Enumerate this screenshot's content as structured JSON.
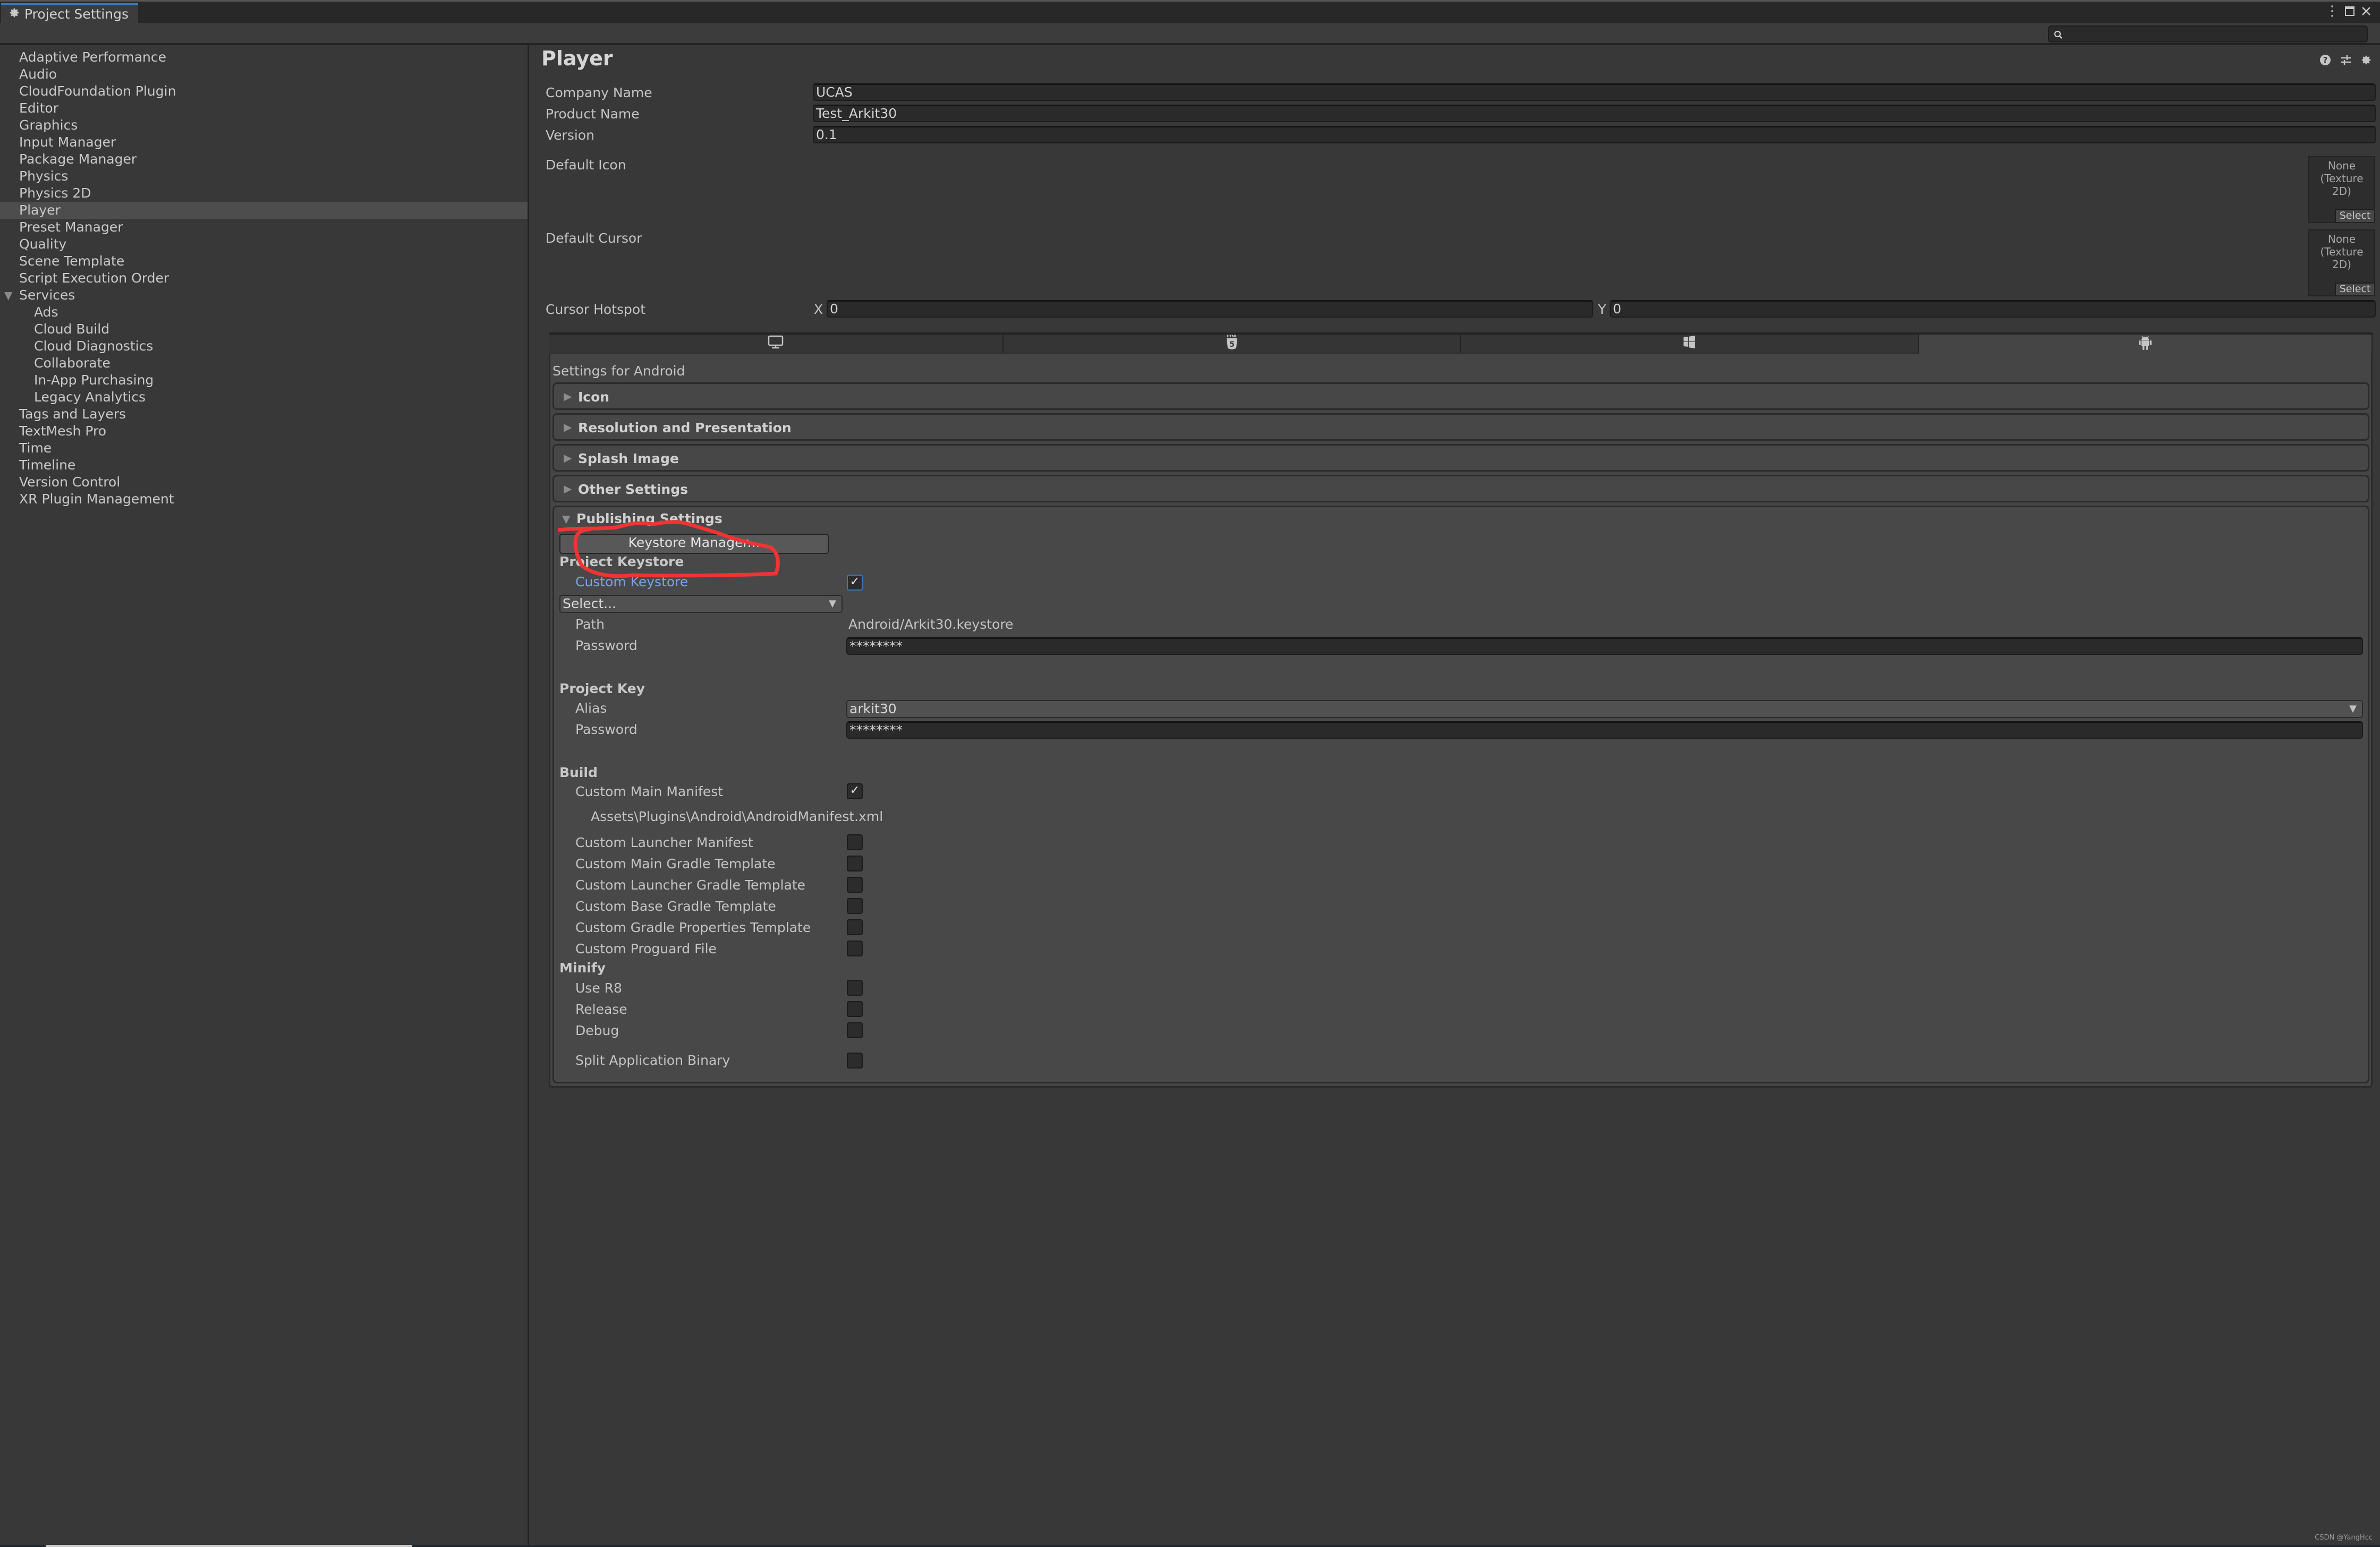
{
  "window": {
    "tab_title": "Project Settings",
    "tab_icon": "gear-icon",
    "controls": [
      "more-options-icon",
      "maximize-icon",
      "close-icon"
    ]
  },
  "search": {
    "placeholder": "",
    "value": ""
  },
  "sidebar": {
    "items": [
      {
        "label": "Adaptive Performance",
        "selected": false,
        "level": 0
      },
      {
        "label": "Audio",
        "selected": false,
        "level": 0
      },
      {
        "label": "CloudFoundation Plugin",
        "selected": false,
        "level": 0
      },
      {
        "label": "Editor",
        "selected": false,
        "level": 0
      },
      {
        "label": "Graphics",
        "selected": false,
        "level": 0
      },
      {
        "label": "Input Manager",
        "selected": false,
        "level": 0
      },
      {
        "label": "Package Manager",
        "selected": false,
        "level": 0
      },
      {
        "label": "Physics",
        "selected": false,
        "level": 0
      },
      {
        "label": "Physics 2D",
        "selected": false,
        "level": 0
      },
      {
        "label": "Player",
        "selected": true,
        "level": 0
      },
      {
        "label": "Preset Manager",
        "selected": false,
        "level": 0
      },
      {
        "label": "Quality",
        "selected": false,
        "level": 0
      },
      {
        "label": "Scene Template",
        "selected": false,
        "level": 0
      },
      {
        "label": "Script Execution Order",
        "selected": false,
        "level": 0
      },
      {
        "label": "Services",
        "selected": false,
        "level": 0,
        "expanded": true
      },
      {
        "label": "Ads",
        "selected": false,
        "level": 1
      },
      {
        "label": "Cloud Build",
        "selected": false,
        "level": 1
      },
      {
        "label": "Cloud Diagnostics",
        "selected": false,
        "level": 1
      },
      {
        "label": "Collaborate",
        "selected": false,
        "level": 1
      },
      {
        "label": "In-App Purchasing",
        "selected": false,
        "level": 1
      },
      {
        "label": "Legacy Analytics",
        "selected": false,
        "level": 1
      },
      {
        "label": "Tags and Layers",
        "selected": false,
        "level": 0
      },
      {
        "label": "TextMesh Pro",
        "selected": false,
        "level": 0
      },
      {
        "label": "Time",
        "selected": false,
        "level": 0
      },
      {
        "label": "Timeline",
        "selected": false,
        "level": 0
      },
      {
        "label": "Version Control",
        "selected": false,
        "level": 0
      },
      {
        "label": "XR Plugin Management",
        "selected": false,
        "level": 0
      }
    ]
  },
  "player": {
    "title": "Player",
    "header_icons": [
      "help-icon",
      "presets-icon",
      "settings-gear-icon"
    ],
    "company_name": {
      "label": "Company Name",
      "value": "UCAS"
    },
    "product_name": {
      "label": "Product Name",
      "value": "Test_Arkit30"
    },
    "version": {
      "label": "Version",
      "value": "0.1"
    },
    "default_icon": {
      "label": "Default Icon",
      "value_line1": "None",
      "value_line2": "(Texture 2D)",
      "select_label": "Select"
    },
    "default_cursor": {
      "label": "Default Cursor",
      "value_line1": "None",
      "value_line2": "(Texture 2D)",
      "select_label": "Select"
    },
    "cursor_hotspot": {
      "label": "Cursor Hotspot",
      "x_label": "X",
      "x_value": "0",
      "y_label": "Y",
      "y_value": "0"
    }
  },
  "platform_tabs": [
    {
      "name": "standalone",
      "icon": "monitor-icon",
      "active": false
    },
    {
      "name": "webgl",
      "icon": "html5-icon",
      "active": false
    },
    {
      "name": "windows-store",
      "icon": "windows-icon",
      "active": false
    },
    {
      "name": "android",
      "icon": "android-icon",
      "active": true
    }
  ],
  "android": {
    "settings_for": "Settings for Android",
    "foldouts": [
      {
        "title": "Icon",
        "expanded": false
      },
      {
        "title": "Resolution and Presentation",
        "expanded": false
      },
      {
        "title": "Splash Image",
        "expanded": false
      },
      {
        "title": "Other Settings",
        "expanded": false
      }
    ],
    "publishing": {
      "title": "Publishing Settings",
      "expanded": true,
      "keystore_manager_button": "Keystore Manager...",
      "project_keystore": {
        "header": "Project Keystore",
        "custom_keystore_label": "Custom Keystore",
        "custom_keystore_checked": true,
        "select_dropdown": "Select...",
        "path_label": "Path",
        "path_value": "Android/Arkit30.keystore",
        "password_label": "Password",
        "password_value": "********"
      },
      "project_key": {
        "header": "Project Key",
        "alias_label": "Alias",
        "alias_value": "arkit30",
        "password_label": "Password",
        "password_value": "********"
      },
      "build": {
        "header": "Build",
        "custom_main_manifest": {
          "label": "Custom Main Manifest",
          "checked": true
        },
        "manifest_path": "Assets\\Plugins\\Android\\AndroidManifest.xml",
        "options": [
          {
            "label": "Custom Launcher Manifest",
            "checked": false
          },
          {
            "label": "Custom Main Gradle Template",
            "checked": false
          },
          {
            "label": "Custom Launcher Gradle Template",
            "checked": false
          },
          {
            "label": "Custom Base Gradle Template",
            "checked": false
          },
          {
            "label": "Custom Gradle Properties Template",
            "checked": false
          },
          {
            "label": "Custom Proguard File",
            "checked": false
          }
        ]
      },
      "minify": {
        "header": "Minify",
        "options": [
          {
            "label": "Use R8",
            "checked": false
          },
          {
            "label": "Release",
            "checked": false
          },
          {
            "label": "Debug",
            "checked": false
          }
        ]
      },
      "split_binary": {
        "label": "Split Application Binary",
        "checked": false
      }
    }
  },
  "annotation": {
    "color": "#f03333",
    "target": "Keystore Manager..."
  },
  "watermark": "CSDN @YangHcc",
  "colors": {
    "accent": "#3a79bb",
    "link": "#7ba4e8",
    "background": "#383838",
    "panel": "#484848"
  }
}
